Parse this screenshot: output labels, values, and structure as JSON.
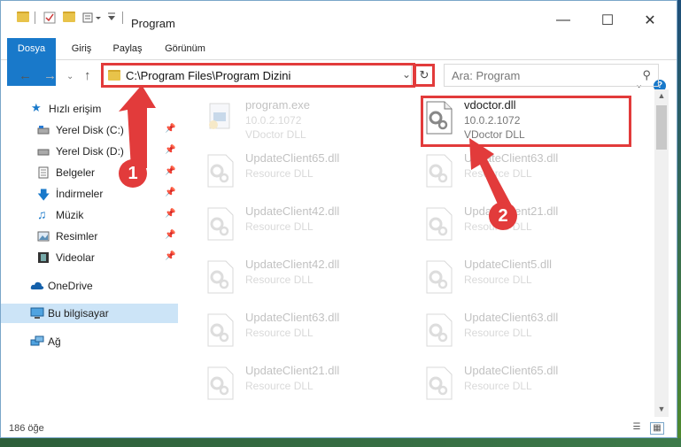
{
  "window": {
    "title": "Program"
  },
  "ribbon": {
    "tabs": [
      "Dosya",
      "Giriş",
      "Paylaş",
      "Görünüm"
    ]
  },
  "address": {
    "path": "C:\\Program Files\\Program Dizini",
    "search_placeholder": "Ara: Program"
  },
  "sidebar": {
    "items": [
      {
        "label": "Hızlı erişim",
        "icon": "star-icon"
      },
      {
        "label": "Yerel Disk (C:)",
        "icon": "drive-icon"
      },
      {
        "label": "Yerel Disk (D:)",
        "icon": "drive-icon"
      },
      {
        "label": "Belgeler",
        "icon": "documents-icon"
      },
      {
        "label": "İndirmeler",
        "icon": "download-icon"
      },
      {
        "label": "Müzik",
        "icon": "music-icon"
      },
      {
        "label": "Resimler",
        "icon": "pictures-icon"
      },
      {
        "label": "Videolar",
        "icon": "video-icon"
      },
      {
        "label": "OneDrive",
        "icon": "cloud-icon"
      },
      {
        "label": "Bu bilgisayar",
        "icon": "computer-icon"
      },
      {
        "label": "Ağ",
        "icon": "network-icon"
      }
    ]
  },
  "files": [
    {
      "name": "program.exe",
      "version": "10.0.2.1072",
      "desc": "VDoctor DLL"
    },
    {
      "name": "vdoctor.dll",
      "version": "10.0.2.1072",
      "desc": "VDoctor DLL"
    },
    {
      "name": "UpdateClient65.dll",
      "desc": "Resource DLL"
    },
    {
      "name": "UpdateClient63.dll",
      "desc": "Resource DLL"
    },
    {
      "name": "UpdateClient42.dll",
      "desc": "Resource DLL"
    },
    {
      "name": "UpdateClient21.dll",
      "desc": "Resource DLL"
    },
    {
      "name": "UpdateClient42.dll",
      "desc": "Resource DLL"
    },
    {
      "name": "UpdateClient5.dll",
      "desc": "Resource DLL"
    },
    {
      "name": "UpdateClient63.dll",
      "desc": "Resource DLL"
    },
    {
      "name": "UpdateClient63.dll",
      "desc": "Resource DLL"
    },
    {
      "name": "UpdateClient21.dll",
      "desc": "Resource DLL"
    },
    {
      "name": "UpdateClient65.dll",
      "desc": "Resource DLL"
    }
  ],
  "status": {
    "count": "186 öğe"
  },
  "annotations": {
    "step1": "1",
    "step2": "2"
  },
  "colors": {
    "accent": "#1979ca",
    "highlight": "#e23b3b",
    "selected": "#cce4f7"
  }
}
